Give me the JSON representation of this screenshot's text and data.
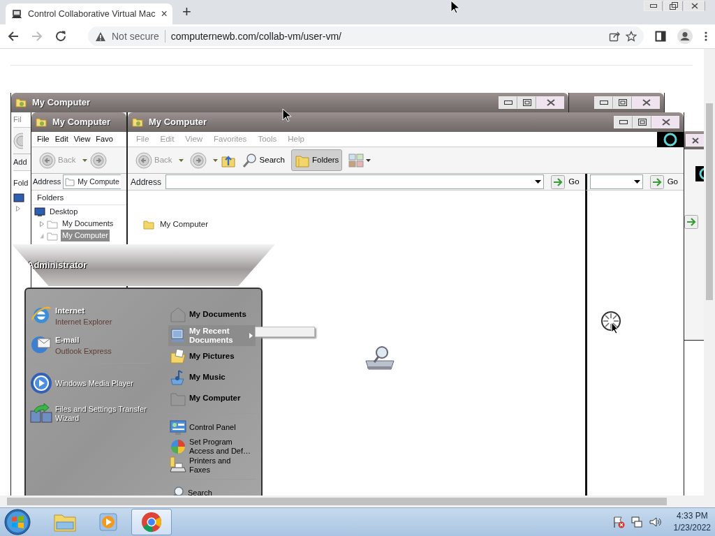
{
  "browser": {
    "tab": {
      "title": "Control Collaborative Virtual Mac",
      "selected": true
    },
    "tab_close": "×",
    "new_tab": "+",
    "security": "Not secure",
    "url": "computernewb.com/collab-vm/user-vm/"
  },
  "vm": {
    "windows": [
      {
        "kind": "untitled"
      },
      {
        "kind": "back",
        "title": "My Computer",
        "menu": "Fil",
        "address_label": "Add",
        "folders_label": "Fold"
      },
      {
        "kind": "edge"
      },
      {
        "kind": "middle",
        "title": "My Computer",
        "menu": [
          {
            "label": "File",
            "disabled": false
          },
          {
            "label": "Edit",
            "disabled": false
          },
          {
            "label": "View",
            "disabled": false
          },
          {
            "label": "Favo",
            "disabled": false
          }
        ],
        "back": "Back",
        "address_label": "Address",
        "address_value": "My Compute",
        "folders_label": "Folders",
        "tree": [
          {
            "label": "Desktop",
            "selected": false,
            "children": [
              {
                "label": "My Documents",
                "selected": false
              },
              {
                "label": "My Computer",
                "selected": true
              }
            ]
          }
        ]
      },
      {
        "kind": "front",
        "title": "My Computer",
        "menu": [
          {
            "label": "File",
            "disabled": true
          },
          {
            "label": "Edit",
            "disabled": true
          },
          {
            "label": "View",
            "disabled": true
          },
          {
            "label": "Favorites",
            "disabled": true
          },
          {
            "label": "Tools",
            "disabled": true
          },
          {
            "label": "Help",
            "disabled": true
          }
        ],
        "toolbar": [
          {
            "kind": "back",
            "label": "Back",
            "disabled": true
          },
          {
            "kind": "forward"
          },
          {
            "kind": "up"
          },
          {
            "kind": "search",
            "label": "Search",
            "pressed": false
          },
          {
            "kind": "folders",
            "label": "Folders",
            "pressed": true
          },
          {
            "kind": "views"
          }
        ],
        "address_label": "Address",
        "go": "Go",
        "items": [
          {
            "label": "My Computer"
          }
        ],
        "side_go": "Go"
      }
    ],
    "start_menu": {
      "user": "Administrator",
      "pinned": [
        {
          "title": "Internet",
          "subtitle": "Internet Explorer",
          "kind": "browser"
        },
        {
          "title": "E-mail",
          "subtitle": "Outlook Express",
          "kind": "mail"
        }
      ],
      "recent": [
        {
          "label": "Windows Media Player",
          "kind": "media"
        },
        {
          "label": "Files and Settings Transfer Wizard",
          "kind": "transfer"
        }
      ],
      "places": [
        [
          {
            "label": "My Documents",
            "kind": "documents",
            "selected": false,
            "expanded": false
          },
          {
            "label": "My Recent Documents",
            "kind": "recent",
            "selected": true,
            "expanded": true
          },
          {
            "label": "My Pictures",
            "kind": "pictures",
            "selected": false,
            "expanded": false
          },
          {
            "label": "My Music",
            "kind": "music",
            "selected": false,
            "expanded": false
          },
          {
            "label": "My Computer",
            "kind": "computer",
            "selected": false,
            "expanded": false
          }
        ],
        [
          {
            "label": "Control Panel",
            "kind": "control",
            "selected": false,
            "expanded": false
          },
          {
            "label": "Set Program Access and Def…",
            "kind": "programs",
            "selected": false,
            "expanded": false
          },
          {
            "label": "Printers and Faxes",
            "kind": "printers",
            "selected": false,
            "expanded": false
          }
        ],
        [
          {
            "label": "Search",
            "kind": "search",
            "selected": false,
            "expanded": false
          }
        ]
      ]
    }
  },
  "taskbar": {
    "buttons": [
      {
        "kind": "explorer",
        "active": false
      },
      {
        "kind": "media",
        "active": false
      },
      {
        "kind": "browser",
        "active": true
      }
    ],
    "time": "4:33 PM",
    "date": "1/23/2022"
  }
}
